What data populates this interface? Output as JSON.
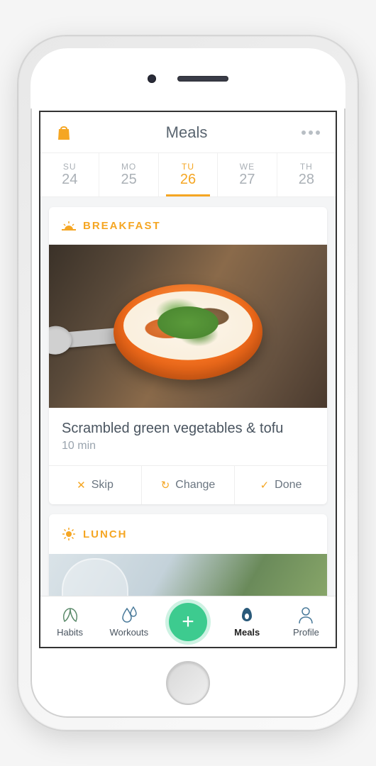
{
  "header": {
    "title": "Meals"
  },
  "days": [
    {
      "dow": "SU",
      "dnum": "24"
    },
    {
      "dow": "MO",
      "dnum": "25"
    },
    {
      "dow": "TU",
      "dnum": "26"
    },
    {
      "dow": "WE",
      "dnum": "27"
    },
    {
      "dow": "TH",
      "dnum": "28"
    }
  ],
  "breakfast": {
    "label": "BREAKFAST",
    "title": "Scrambled green vegetables & tofu",
    "time": "10 min",
    "actions": {
      "skip": "Skip",
      "change": "Change",
      "done": "Done"
    }
  },
  "lunch": {
    "label": "LUNCH"
  },
  "tabs": {
    "habits": "Habits",
    "workouts": "Workouts",
    "meals": "Meals",
    "profile": "Profile"
  }
}
